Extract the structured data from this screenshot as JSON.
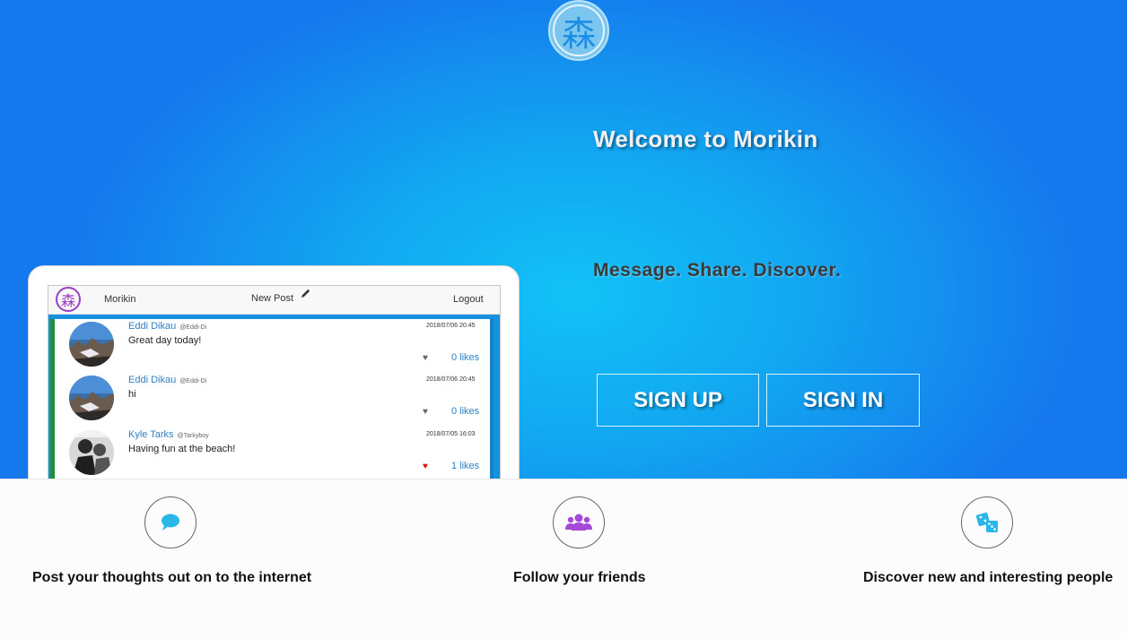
{
  "hero": {
    "logo_glyph": "森",
    "welcome": "Welcome to Morikin",
    "tagline": "Message. Share. Discover.",
    "signup_label": "SIGN UP",
    "signin_label": "SIGN IN"
  },
  "mockup": {
    "nav": {
      "logo_glyph": "森",
      "brand": "Morikin",
      "new_post": "New Post",
      "pencil_icon": "pencil-icon",
      "logout": "Logout"
    },
    "posts": [
      {
        "name": "Eddi Dikau",
        "handle": "@Eddi-Di",
        "text": "Great day today!",
        "date": "2018/07/06 20:45",
        "heart": "♥",
        "heart_color": "#666666",
        "likes": "0 likes"
      },
      {
        "name": "Eddi Dikau",
        "handle": "@Eddi-Di",
        "text": "hi",
        "date": "2018/07/06 20:45",
        "heart": "♥",
        "heart_color": "#666666",
        "likes": "0 likes"
      },
      {
        "name": "Kyle Tarks",
        "handle": "@Tarkyboy",
        "text": "Having fun at the beach!",
        "date": "2018/07/05 16:03",
        "heart": "♥",
        "heart_color": "#e01010",
        "likes": "1 likes"
      }
    ]
  },
  "features": [
    {
      "icon": "chat-bubble-icon",
      "icon_color": "#29b6e8",
      "text": "Post your thoughts out on to the internet"
    },
    {
      "icon": "users-group-icon",
      "icon_color": "#a54ad6",
      "text": "Follow your friends"
    },
    {
      "icon": "dice-icon",
      "icon_color": "#29b6e8",
      "text": "Discover new and interesting people"
    }
  ],
  "colors": {
    "hero_light": "#12c2f7",
    "hero_dark": "#1579ed",
    "link_blue": "#2f7fc4",
    "logo_purple": "#9b3fc4"
  }
}
